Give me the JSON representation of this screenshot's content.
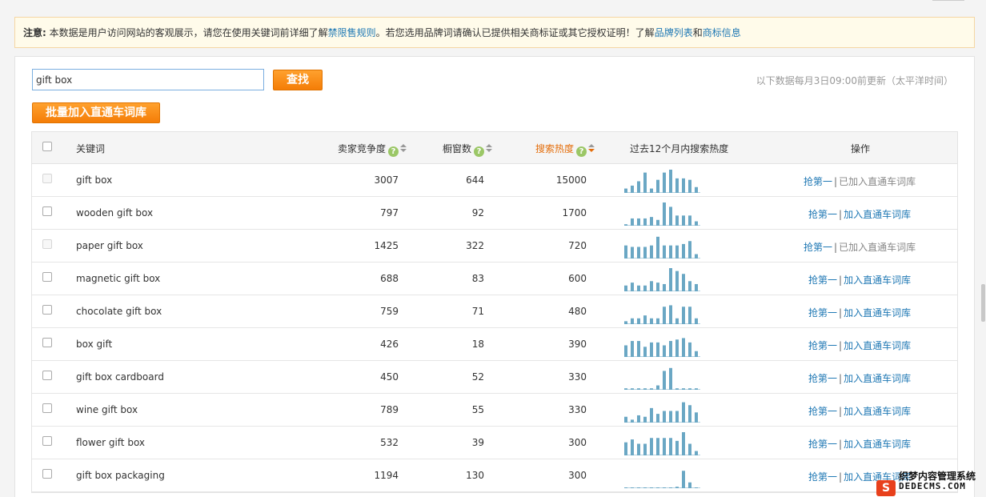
{
  "notice": {
    "label": "注意:",
    "text1": "本数据是用户访问网站的客观展示，请您在使用关键词前详细了解",
    "link1": "禁限售规则",
    "text2": "。若您选用品牌词请确认已提供相关商标证或其它授权证明！了解",
    "link2": "品牌列表",
    "text3": "和",
    "link3": "商标信息"
  },
  "search": {
    "value": "gift box",
    "button": "查找"
  },
  "update_note": "以下数据每月3日09:00前更新（太平洋时间）",
  "batch_button": "批量加入直通车词库",
  "table": {
    "headers": {
      "keyword": "关键词",
      "competition": "卖家竞争度",
      "showcase": "橱窗数",
      "heat": "搜索热度",
      "trend": "过去12个月内搜索热度",
      "action": "操作"
    },
    "qmark": "?",
    "action_first": "抢第一",
    "action_sep": "|",
    "action_add": "加入直通车词库",
    "action_added": "已加入直通车词库",
    "rows": [
      {
        "keyword": "gift box",
        "competition": "3007",
        "showcase": "644",
        "heat": "15000",
        "added": true,
        "trend": [
          3,
          5,
          8,
          14,
          3,
          9,
          14,
          16,
          10,
          10,
          9,
          4
        ]
      },
      {
        "keyword": "wooden gift box",
        "competition": "797",
        "showcase": "92",
        "heat": "1700",
        "added": false,
        "trend": [
          1,
          5,
          5,
          5,
          6,
          4,
          16,
          13,
          7,
          7,
          7,
          3
        ]
      },
      {
        "keyword": "paper gift box",
        "competition": "1425",
        "showcase": "322",
        "heat": "720",
        "added": true,
        "trend": [
          9,
          8,
          8,
          8,
          9,
          15,
          9,
          9,
          9,
          10,
          12,
          3
        ]
      },
      {
        "keyword": "magnetic gift box",
        "competition": "688",
        "showcase": "83",
        "heat": "600",
        "added": false,
        "trend": [
          4,
          6,
          4,
          4,
          7,
          6,
          5,
          16,
          14,
          12,
          7,
          5
        ]
      },
      {
        "keyword": "chocolate gift box",
        "competition": "759",
        "showcase": "71",
        "heat": "480",
        "added": false,
        "trend": [
          2,
          4,
          4,
          6,
          4,
          4,
          12,
          13,
          4,
          12,
          12,
          4
        ]
      },
      {
        "keyword": "box gift",
        "competition": "426",
        "showcase": "18",
        "heat": "390",
        "added": false,
        "trend": [
          8,
          11,
          11,
          7,
          10,
          10,
          8,
          11,
          12,
          13,
          10,
          4
        ]
      },
      {
        "keyword": "gift box cardboard",
        "competition": "450",
        "showcase": "52",
        "heat": "330",
        "added": false,
        "trend": [
          1,
          1,
          1,
          1,
          1,
          3,
          13,
          15,
          1,
          1,
          1,
          1
        ]
      },
      {
        "keyword": "wine gift box",
        "competition": "789",
        "showcase": "55",
        "heat": "330",
        "added": false,
        "trend": [
          4,
          2,
          5,
          4,
          10,
          6,
          8,
          8,
          8,
          14,
          12,
          7
        ]
      },
      {
        "keyword": "flower gift box",
        "competition": "532",
        "showcase": "39",
        "heat": "300",
        "added": false,
        "trend": [
          9,
          11,
          8,
          8,
          12,
          12,
          12,
          12,
          10,
          16,
          8,
          3
        ]
      },
      {
        "keyword": "gift box packaging",
        "competition": "1194",
        "showcase": "130",
        "heat": "300",
        "added": false,
        "trend": [
          0,
          0,
          0,
          0,
          0,
          0,
          0,
          0,
          1,
          12,
          4,
          0
        ]
      }
    ]
  },
  "watermark": {
    "badge": "S",
    "top_text": "织梦内容管理系统",
    "bottom_text": "DEDECMS.COM"
  },
  "colors": {
    "accent_orange": "#f47d07",
    "link_blue": "#1f78b4",
    "spark_bar": "#6aa7c4",
    "help_green": "#9bc766"
  }
}
